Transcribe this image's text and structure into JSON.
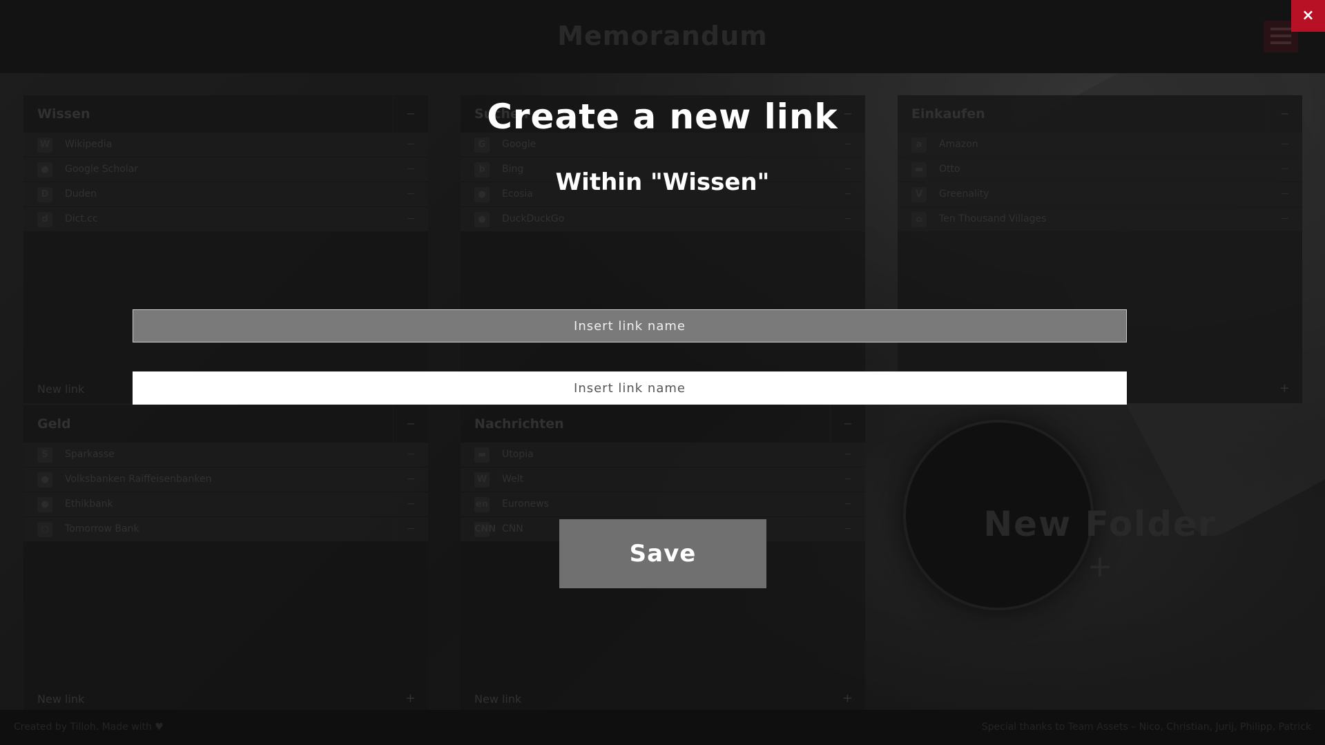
{
  "app": {
    "title": "Memorandum"
  },
  "folders": [
    {
      "title": "Wissen",
      "links": [
        {
          "icon": "W",
          "label": "Wikipedia"
        },
        {
          "icon": "●",
          "label": "Google Scholar"
        },
        {
          "icon": "D",
          "label": "Duden"
        },
        {
          "icon": "d",
          "label": "Dict.cc"
        }
      ]
    },
    {
      "title": "Suchen",
      "links": [
        {
          "icon": "G",
          "label": "Google"
        },
        {
          "icon": "b",
          "label": "Bing"
        },
        {
          "icon": "●",
          "label": "Ecosia"
        },
        {
          "icon": "●",
          "label": "DuckDuckGo"
        }
      ]
    },
    {
      "title": "Einkaufen",
      "links": [
        {
          "icon": "a",
          "label": "Amazon"
        },
        {
          "icon": "▬",
          "label": "Otto"
        },
        {
          "icon": "V",
          "label": "Greenality"
        },
        {
          "icon": "⌂",
          "label": "Ten Thousand Villages"
        }
      ]
    },
    {
      "title": "Geld",
      "links": [
        {
          "icon": "S",
          "label": "Sparkasse"
        },
        {
          "icon": "●",
          "label": "Volksbanken Raiffeisenbanken"
        },
        {
          "icon": "●",
          "label": "Ethikbank"
        },
        {
          "icon": "○",
          "label": "Tomorrow Bank"
        }
      ]
    },
    {
      "title": "Nachrichten",
      "links": [
        {
          "icon": "▬",
          "label": "Utopia"
        },
        {
          "icon": "W",
          "label": "Welt"
        },
        {
          "icon": "en",
          "label": "Euronews"
        },
        {
          "icon": "CNN",
          "label": "CNN"
        }
      ]
    }
  ],
  "folder_controls": {
    "minus": "−",
    "new_link": "New link",
    "plus": "+"
  },
  "new_folder": {
    "label": "New Folder",
    "plus": "+"
  },
  "footer": {
    "left": "Created by Tilloh. Made with ♥",
    "right": "Special thanks to Team Assets – Nico, Christian, Jurij, Philipp, Patrick"
  },
  "modal": {
    "close": "×",
    "title": "Create a new link",
    "subtitle": "Within \"Wissen\"",
    "name_placeholder": "Insert link name",
    "url_placeholder": "Insert link name",
    "save_label": "Save"
  }
}
